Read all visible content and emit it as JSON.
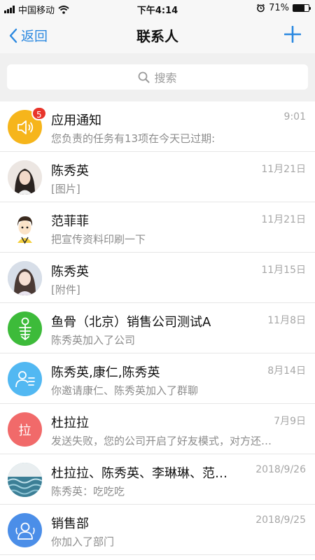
{
  "status_bar": {
    "carrier": "中国移动",
    "time": "下午4:14",
    "battery": "71%",
    "battery_level": 0.71
  },
  "nav": {
    "back_label": "返回",
    "title": "联系人"
  },
  "search": {
    "placeholder": "搜索"
  },
  "conversations": [
    {
      "name": "应用通知",
      "preview": "您负责的任务有13项在今天已过期:",
      "time": "9:01",
      "badge": "5",
      "avatar": "speaker-icon",
      "avatar_color": "#f6b51b"
    },
    {
      "name": "陈秀英",
      "preview": "[图片]",
      "time": "11月21日",
      "avatar": "photo",
      "avatar_color": "#d9c9c0"
    },
    {
      "name": "范菲菲",
      "preview": "把宣传资料印刷一下",
      "time": "11月21日",
      "avatar": "cartoon",
      "avatar_color": "#ffffff"
    },
    {
      "name": "陈秀英",
      "preview": "[附件]",
      "time": "11月15日",
      "avatar": "photo",
      "avatar_color": "#c9d3e0"
    },
    {
      "name": "鱼骨（北京）销售公司测试A",
      "preview": "陈秀英加入了公司",
      "time": "11月8日",
      "avatar": "fishbone-icon",
      "avatar_color": "#3dbb3a"
    },
    {
      "name": "陈秀英,康仁,陈秀英",
      "preview": "你邀请康仁、陈秀英加入了群聊",
      "time": "8月14日",
      "avatar": "group-chat-icon",
      "avatar_color": "#52b8f2"
    },
    {
      "name": "杜拉拉",
      "preview": "发送失败，您的公司开启了好友模式，对方还…",
      "time": "7月9日",
      "avatar_text": "拉",
      "avatar_color": "#f16a6a"
    },
    {
      "name": "杜拉拉、陈秀英、李琳琳、范…",
      "preview": "陈秀英：吃吃吃",
      "time": "2018/9/26",
      "avatar": "sea-image",
      "avatar_color": "#6ea7b8"
    },
    {
      "name": "销售部",
      "preview": "你加入了部门",
      "time": "2018/9/25",
      "avatar": "department-icon",
      "avatar_color": "#4b8ee8"
    }
  ],
  "colors": {
    "accent": "#2a88e0",
    "badge": "#e8352b"
  }
}
